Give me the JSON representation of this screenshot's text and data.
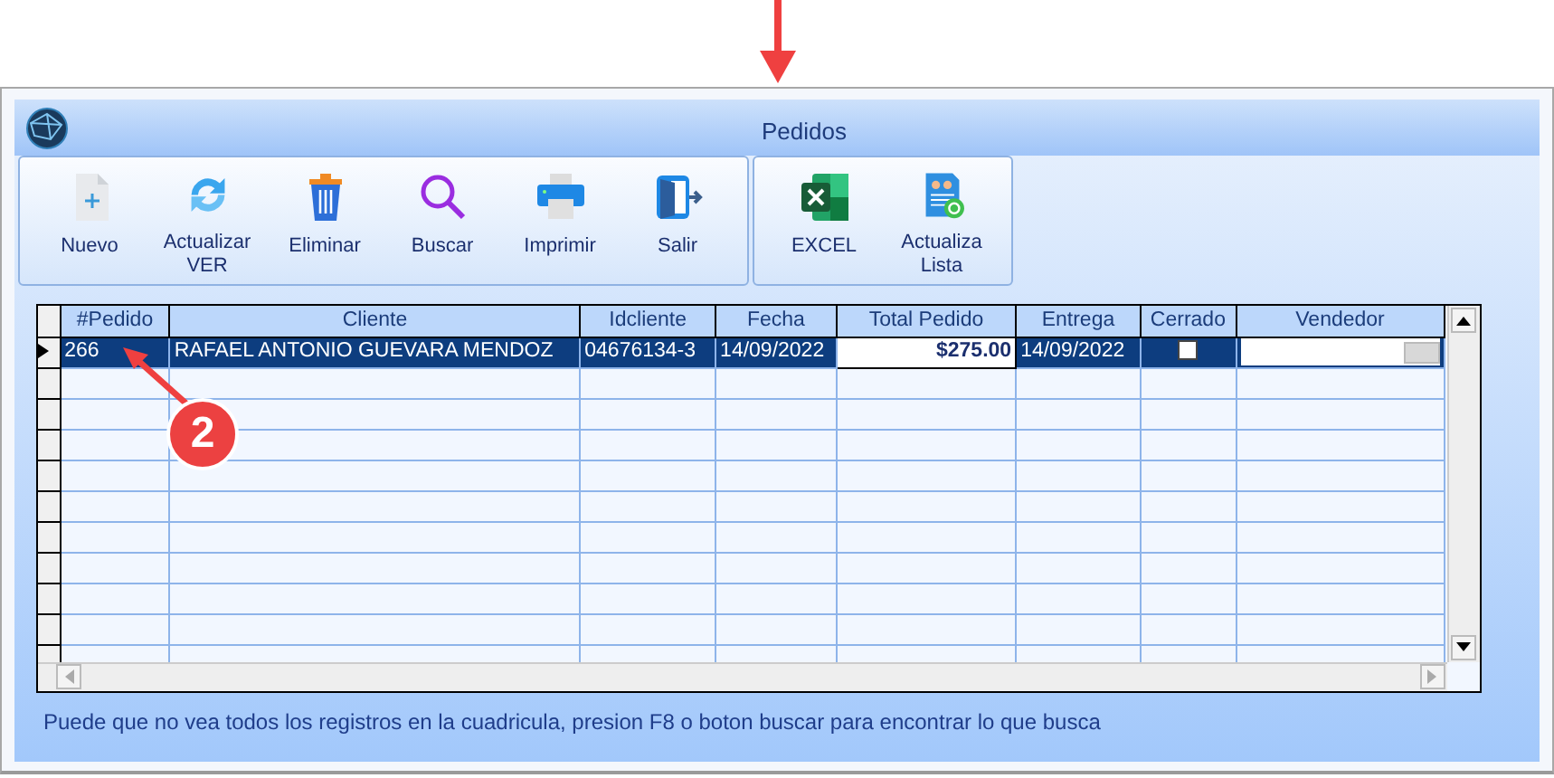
{
  "window": {
    "title": "Pedidos"
  },
  "toolbar_groups": [
    {
      "buttons": [
        {
          "kind": "new",
          "label": "Nuevo"
        },
        {
          "kind": "refresh",
          "label": "Actualizar VER"
        },
        {
          "kind": "delete",
          "label": "Eliminar"
        },
        {
          "kind": "search",
          "label": "Buscar"
        },
        {
          "kind": "print",
          "label": "Imprimir"
        },
        {
          "kind": "exit",
          "label": "Salir"
        }
      ]
    },
    {
      "buttons": [
        {
          "kind": "excel",
          "label": "EXCEL"
        },
        {
          "kind": "list",
          "label": "Actualiza Lista"
        }
      ]
    }
  ],
  "grid": {
    "columns": [
      "#Pedido",
      "Cliente",
      "Idcliente",
      "Fecha",
      "Total Pedido",
      "Entrega",
      "Cerrado",
      "Vendedor"
    ],
    "rows": [
      {
        "selected": true,
        "cells": [
          {
            "kind": "text",
            "text": "266"
          },
          {
            "kind": "text",
            "text": "RAFAEL ANTONIO GUEVARA MENDOZ"
          },
          {
            "kind": "text",
            "text": "04676134-3"
          },
          {
            "kind": "text",
            "text": "14/09/2022"
          },
          {
            "kind": "money",
            "text": "$275.00",
            "current": true
          },
          {
            "kind": "text",
            "text": "14/09/2022"
          },
          {
            "kind": "check",
            "checked": false
          },
          {
            "kind": "combo"
          }
        ]
      }
    ]
  },
  "status_text": "Puede que no vea todos los registros en la cuadricula, presion F8 o boton buscar para encontrar lo que busca",
  "annotations": [
    {
      "kind": "arrow"
    },
    {
      "kind": "numbered",
      "label": "2"
    }
  ]
}
